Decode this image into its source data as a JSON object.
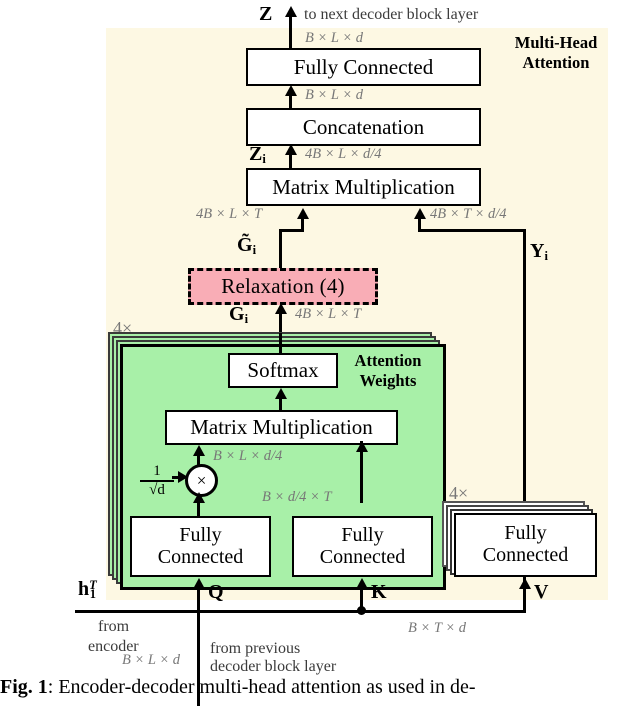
{
  "figure": {
    "caption_bold": "Fig. 1",
    "caption_rest": ": Encoder-decoder multi-head attention as used in de-"
  },
  "colors": {
    "panel_background": "#fdf8e3",
    "head_block_green": "#a8f0a8",
    "relaxation_pink": "#f9adb6",
    "line_black": "#000000",
    "dimension_text_gray": "#777777"
  },
  "panel": {
    "title_line1": "Multi-Head",
    "title_line2": "Attention"
  },
  "top": {
    "output_symbol": "Z",
    "output_note": "to next decoder block layer",
    "dim_out": "B × L × d"
  },
  "blocks": {
    "fully_connected_top": "Fully Connected",
    "concatenation": "Concatenation",
    "matrix_multiplication_top": "Matrix Multiplication",
    "relaxation": "Relaxation   (4)",
    "softmax": "Softmax",
    "matrix_multiplication_head": "Matrix Multiplication",
    "fc_query_line1": "Fully",
    "fc_query_line2": "Connected",
    "fc_key_line1": "Fully",
    "fc_key_line2": "Connected",
    "fc_value_line1": "Fully",
    "fc_value_line2": "Connected"
  },
  "dims": {
    "fc_to_z": "B × L × d",
    "concat_to_fc": "B × L × d",
    "mm_to_concat": "4B × L × d/4",
    "gtilde_to_mm": "4B × L × T",
    "y_to_mm": "4B × T × d/4",
    "g_to_relax": "4B × L × T",
    "scaled_q": "B × L × d/4",
    "key_out": "B × d/4 × T",
    "query_in": "B × L × d",
    "key_value_in": "B × T × d"
  },
  "symbols": {
    "z_i": "Z",
    "z_i_sub": "i",
    "g_tilde": "G̃",
    "g_tilde_sub": "i",
    "g": "G",
    "g_sub": "i",
    "y": "Y",
    "y_sub": "i",
    "q": "Q",
    "k": "K",
    "v": "V",
    "h_enc": "h",
    "h_enc_sub": "1",
    "h_enc_sup": "T",
    "scale_numerator": "1",
    "scale_denominator": "√d",
    "multiply_glyph": "×"
  },
  "annotations": {
    "attention_weights_line1": "Attention",
    "attention_weights_line2": "Weights",
    "heads_multiplier_left": "4×",
    "heads_multiplier_right": "4×",
    "from_encoder_line1": "from",
    "from_encoder_line2": "encoder",
    "from_previous_line1": "from previous",
    "from_previous_line2": "decoder block layer"
  }
}
